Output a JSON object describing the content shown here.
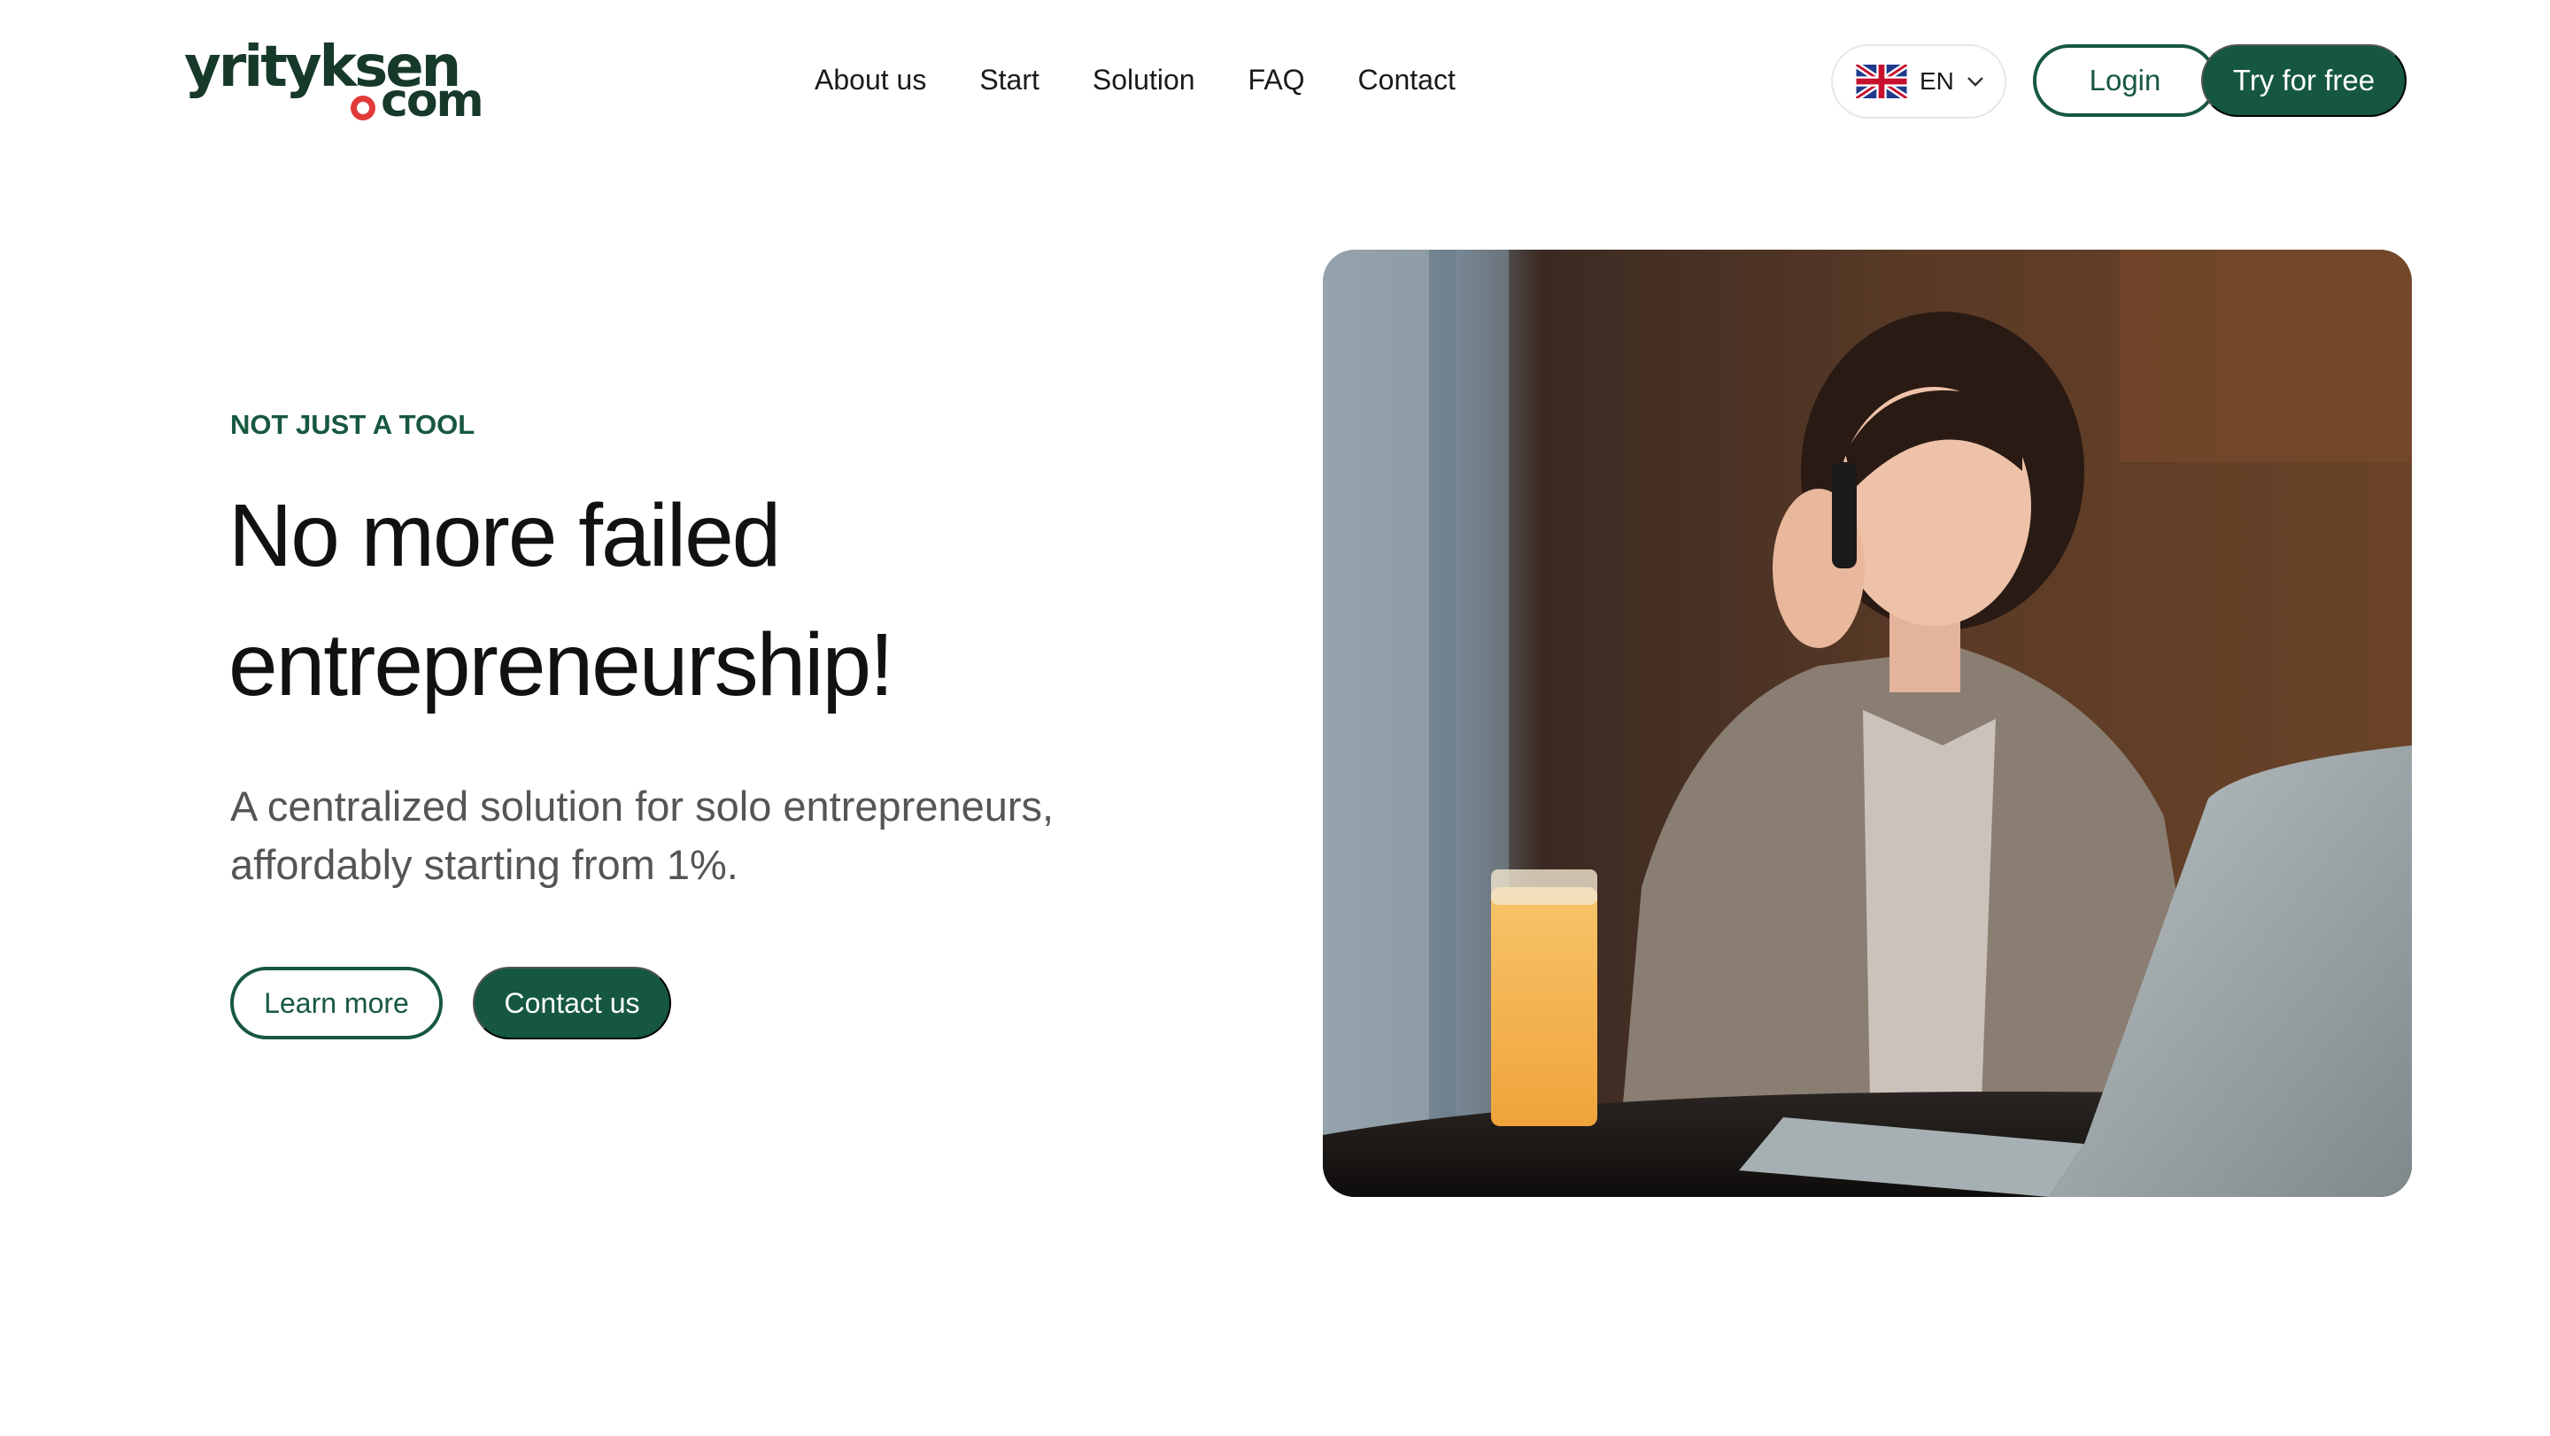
{
  "header": {
    "logo": {
      "top": "yrityksen",
      "bottom": "com",
      "accent_color": "#e23a3a",
      "brand_color": "#17392a"
    },
    "nav": [
      "About us",
      "Start",
      "Solution",
      "FAQ",
      "Contact"
    ],
    "language": {
      "code": "EN",
      "flag_icon": "uk-flag-icon"
    },
    "login_label": "Login",
    "try_label": "Try for free"
  },
  "hero": {
    "eyebrow": "NOT JUST A TOOL",
    "headline_line1": "No more failed",
    "headline_line2": "entrepreneurship!",
    "subtext_line1": "A centralized solution for solo entrepreneurs,",
    "subtext_line2": "affordably starting from 1%.",
    "learn_more_label": "Learn more",
    "contact_label": "Contact us",
    "accent_color": "#155741"
  }
}
